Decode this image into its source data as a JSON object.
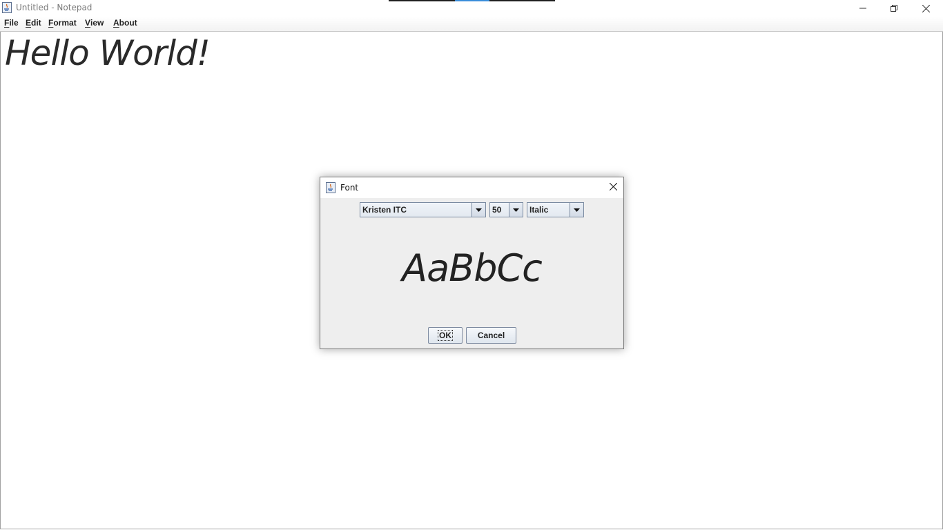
{
  "window": {
    "title": "Untitled - Notepad",
    "icons": {
      "app": "java-app-icon",
      "minimize": "minimize-icon",
      "restore": "restore-icon",
      "close": "close-icon"
    }
  },
  "menubar": {
    "items": [
      {
        "mnemonic": "F",
        "rest": "ile"
      },
      {
        "mnemonic": "E",
        "rest": "dit"
      },
      {
        "mnemonic": "F",
        "rest": "ormat"
      },
      {
        "mnemonic": "V",
        "rest": "iew"
      },
      {
        "mnemonic": "A",
        "rest": "bout"
      }
    ]
  },
  "editor": {
    "content": "Hello World!",
    "font_style": "italic",
    "text_color": "#2a2a2a"
  },
  "font_dialog": {
    "title": "Font",
    "icons": {
      "app": "java-app-icon",
      "close": "close-icon"
    },
    "font_family": "Kristen ITC",
    "font_size": "50",
    "font_style": "Italic",
    "preview_text": "AaBbCc",
    "ok_label": "OK",
    "cancel_label": "Cancel"
  },
  "colors": {
    "dialog_bg": "#eeeeee",
    "combo_border": "#7a8aa0",
    "title_text": "#7a7a7a"
  }
}
